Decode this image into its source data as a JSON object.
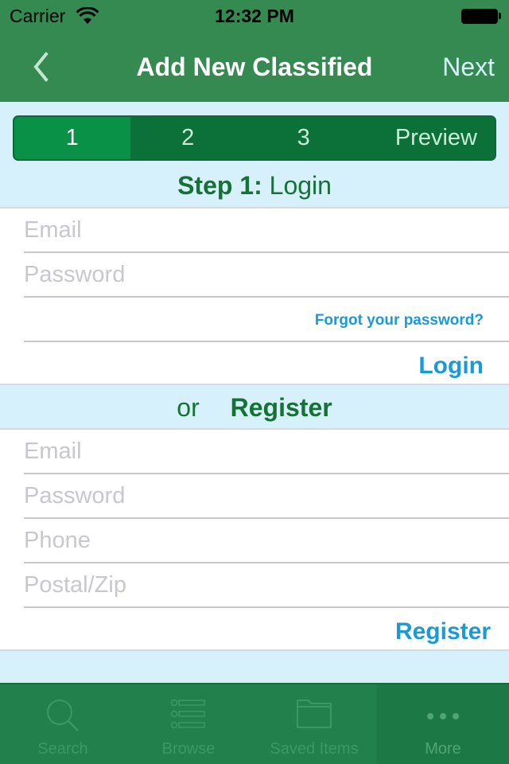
{
  "status_bar": {
    "carrier": "Carrier",
    "time": "12:32 PM"
  },
  "nav": {
    "title": "Add New Classified",
    "next_label": "Next"
  },
  "steps": {
    "items": [
      "1",
      "2",
      "3",
      "Preview"
    ],
    "active_index": 0
  },
  "login_section": {
    "header_bold": "Step 1:",
    "header_regular": "Login",
    "email_placeholder": "Email",
    "password_placeholder": "Password",
    "forgot_label": "Forgot your password?",
    "login_label": "Login"
  },
  "register_section": {
    "header_or": "or",
    "header_bold": "Register",
    "email_placeholder": "Email",
    "password_placeholder": "Password",
    "phone_placeholder": "Phone",
    "postal_placeholder": "Postal/Zip",
    "register_label": "Register"
  },
  "tabbar": {
    "items": [
      {
        "label": "Search",
        "icon": "search-icon"
      },
      {
        "label": "Browse",
        "icon": "list-icon"
      },
      {
        "label": "Saved Items",
        "icon": "folder-icon"
      },
      {
        "label": "More",
        "icon": "more-icon"
      }
    ],
    "selected_index": 3
  },
  "colors": {
    "nav_green": "#348a51",
    "accent_blue": "#1a9ad6",
    "section_bg": "#d6f1fc",
    "header_text_green": "#167135"
  }
}
